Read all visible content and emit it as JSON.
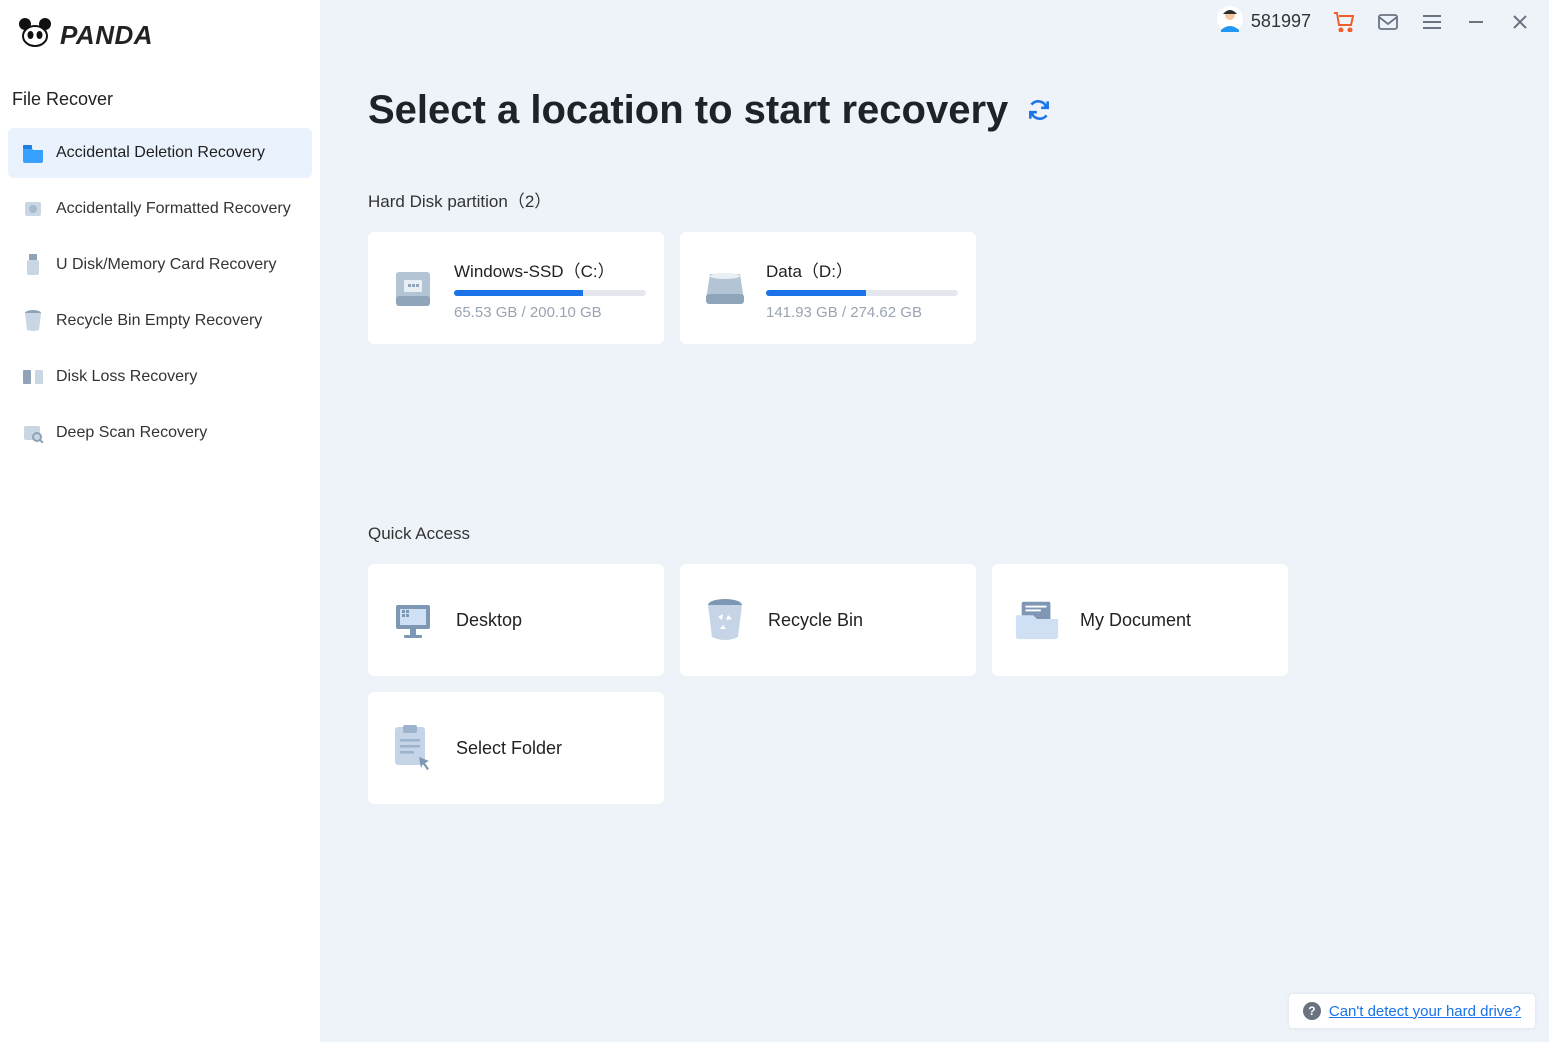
{
  "brand": "PANDA",
  "sidebar": {
    "section_title": "File Recover",
    "items": [
      {
        "label": "Accidental Deletion Recovery",
        "active": true
      },
      {
        "label": "Accidentally Formatted Recovery",
        "active": false
      },
      {
        "label": "U Disk/Memory Card Recovery",
        "active": false
      },
      {
        "label": "Recycle Bin Empty Recovery",
        "active": false
      },
      {
        "label": "Disk Loss Recovery",
        "active": false
      },
      {
        "label": "Deep Scan Recovery",
        "active": false
      }
    ]
  },
  "topbar": {
    "user_id": "581997"
  },
  "page": {
    "title": "Select a location to start recovery"
  },
  "partitions": {
    "heading": "Hard Disk partition",
    "count": "（2）",
    "items": [
      {
        "name": "Windows-SSD",
        "letter": "（C:）",
        "used": "65.53 GB",
        "total": "200.10 GB",
        "fill_pct": 67
      },
      {
        "name": "Data",
        "letter": "（D:）",
        "used": "141.93 GB",
        "total": "274.62 GB",
        "fill_pct": 52
      }
    ]
  },
  "quick_access": {
    "heading": "Quick Access",
    "items": [
      {
        "label": "Desktop"
      },
      {
        "label": "Recycle Bin"
      },
      {
        "label": "My Document"
      },
      {
        "label": "Select Folder"
      }
    ]
  },
  "help": {
    "link_text": "Can't detect your hard drive?"
  }
}
